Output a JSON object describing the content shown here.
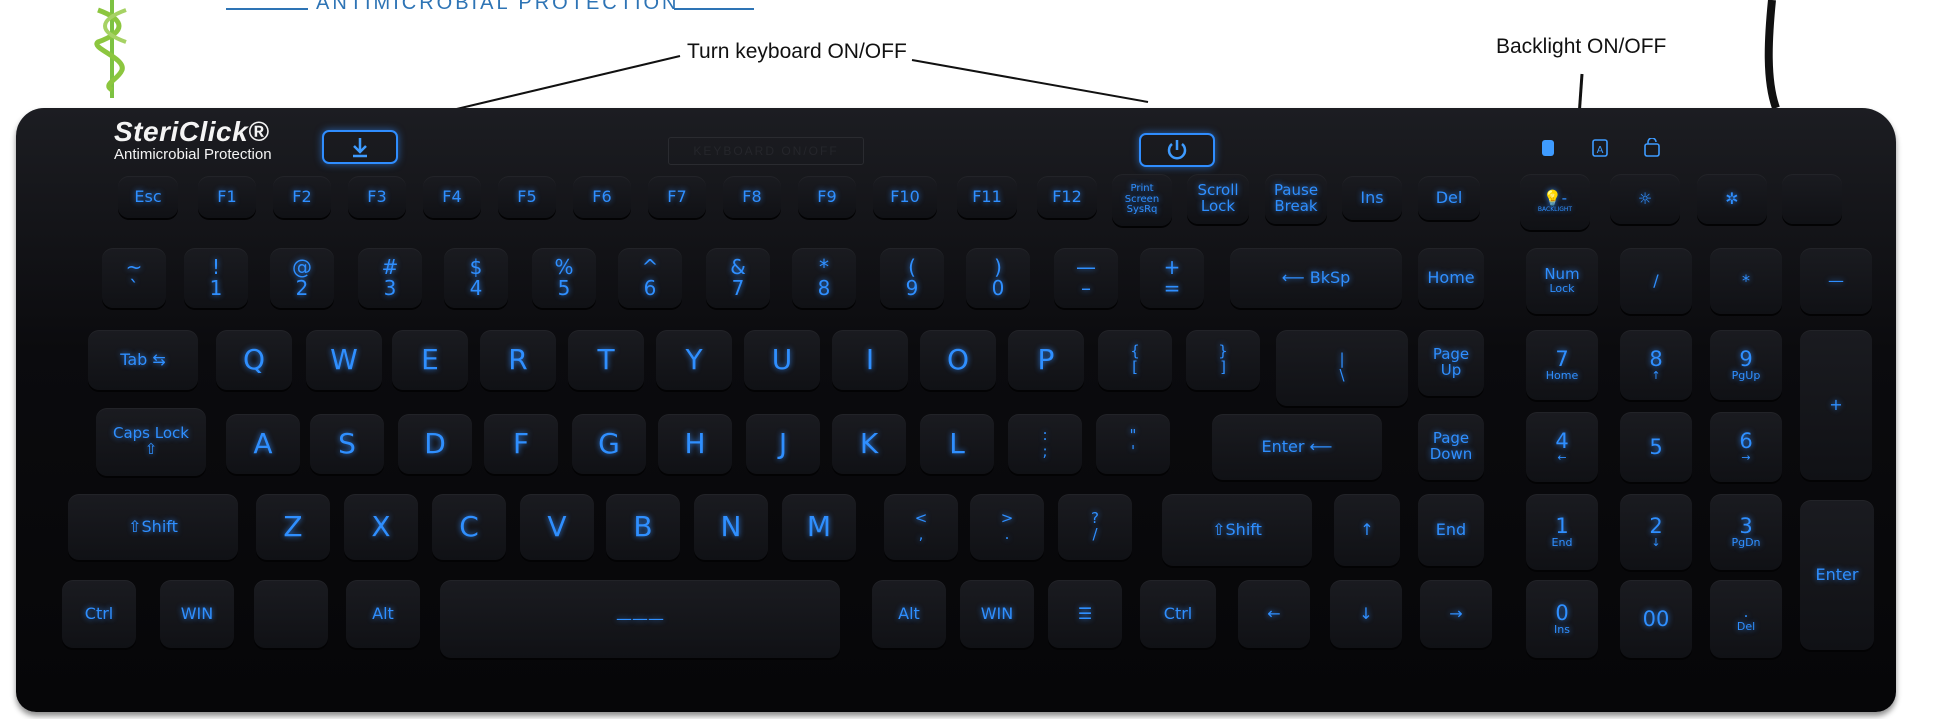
{
  "header": {
    "title": "ANTIMICROBIAL PROTECTION"
  },
  "callouts": {
    "power": "Turn keyboard ON/OFF",
    "backlight": "Backlight ON/OFF"
  },
  "brand": {
    "name": "SteriClick®",
    "tagline": "Antimicrobial Protection"
  },
  "engraving": "KEYBOARD ON/OFF",
  "indicators": [
    "num-lock-indicator-icon",
    "caps-lock-indicator-icon",
    "scroll-lock-indicator-icon"
  ],
  "colors": {
    "key_glow": "#2f8fff",
    "keyboard_body": "#0b0b0e",
    "header_blue": "#2e74b5"
  },
  "keys": [
    {
      "id": "esc",
      "lines": [
        "Esc"
      ]
    },
    {
      "id": "f1",
      "lines": [
        "F1"
      ]
    },
    {
      "id": "f2",
      "lines": [
        "F2"
      ]
    },
    {
      "id": "f3",
      "lines": [
        "F3"
      ]
    },
    {
      "id": "f4",
      "lines": [
        "F4"
      ]
    },
    {
      "id": "f5",
      "lines": [
        "F5"
      ]
    },
    {
      "id": "f6",
      "lines": [
        "F6"
      ]
    },
    {
      "id": "f7",
      "lines": [
        "F7"
      ]
    },
    {
      "id": "f8",
      "lines": [
        "F8"
      ]
    },
    {
      "id": "f9",
      "lines": [
        "F9"
      ]
    },
    {
      "id": "f10",
      "lines": [
        "F10"
      ]
    },
    {
      "id": "f11",
      "lines": [
        "F11"
      ]
    },
    {
      "id": "f12",
      "lines": [
        "F12"
      ]
    },
    {
      "id": "print-screen",
      "lines": [
        "Print",
        "Screen",
        "SysRq"
      ]
    },
    {
      "id": "scroll-lock",
      "lines": [
        "Scroll",
        "Lock"
      ]
    },
    {
      "id": "pause-break",
      "lines": [
        "Pause",
        "Break"
      ]
    },
    {
      "id": "ins",
      "lines": [
        "Ins"
      ]
    },
    {
      "id": "del",
      "lines": [
        "Del"
      ]
    },
    {
      "id": "backlight",
      "lines": [
        "💡-",
        "BACKLIGHT"
      ]
    },
    {
      "id": "brightness-down",
      "lines": [
        "☼"
      ]
    },
    {
      "id": "brightness-up",
      "lines": [
        "✲"
      ]
    },
    {
      "id": "blank-top",
      "lines": [
        ""
      ]
    },
    {
      "id": "tilde",
      "lines": [
        "~",
        "`"
      ]
    },
    {
      "id": "1",
      "lines": [
        "!",
        "1"
      ]
    },
    {
      "id": "2",
      "lines": [
        "@",
        "2"
      ]
    },
    {
      "id": "3",
      "lines": [
        "#",
        "3"
      ]
    },
    {
      "id": "4",
      "lines": [
        "$",
        "4"
      ]
    },
    {
      "id": "5",
      "lines": [
        "%",
        "5"
      ]
    },
    {
      "id": "6",
      "lines": [
        "^",
        "6"
      ]
    },
    {
      "id": "7",
      "lines": [
        "&",
        "7"
      ]
    },
    {
      "id": "8",
      "lines": [
        "*",
        "8"
      ]
    },
    {
      "id": "9",
      "lines": [
        "(",
        "9"
      ]
    },
    {
      "id": "0",
      "lines": [
        ")",
        "0"
      ]
    },
    {
      "id": "minus",
      "lines": [
        "—",
        "–"
      ]
    },
    {
      "id": "equals",
      "lines": [
        "+",
        "="
      ]
    },
    {
      "id": "backspace",
      "lines": [
        "⟵ BkSp"
      ]
    },
    {
      "id": "home",
      "lines": [
        "Home"
      ]
    },
    {
      "id": "num-lock",
      "lines": [
        "Num",
        "Lock"
      ]
    },
    {
      "id": "num-slash",
      "lines": [
        "/"
      ]
    },
    {
      "id": "num-star",
      "lines": [
        "*"
      ]
    },
    {
      "id": "num-minus",
      "lines": [
        "—"
      ]
    },
    {
      "id": "tab",
      "lines": [
        "Tab ⇆"
      ]
    },
    {
      "id": "q",
      "lines": [
        "Q"
      ]
    },
    {
      "id": "w",
      "lines": [
        "W"
      ]
    },
    {
      "id": "e",
      "lines": [
        "E"
      ]
    },
    {
      "id": "r",
      "lines": [
        "R"
      ]
    },
    {
      "id": "t",
      "lines": [
        "T"
      ]
    },
    {
      "id": "y",
      "lines": [
        "Y"
      ]
    },
    {
      "id": "u",
      "lines": [
        "U"
      ]
    },
    {
      "id": "i",
      "lines": [
        "I"
      ]
    },
    {
      "id": "o",
      "lines": [
        "O"
      ]
    },
    {
      "id": "p",
      "lines": [
        "P"
      ]
    },
    {
      "id": "lbrace",
      "lines": [
        "{",
        "["
      ]
    },
    {
      "id": "rbrace",
      "lines": [
        "}",
        "]"
      ]
    },
    {
      "id": "backslash",
      "lines": [
        "|",
        "\\"
      ]
    },
    {
      "id": "page-up",
      "lines": [
        "Page",
        "Up"
      ]
    },
    {
      "id": "num7",
      "lines": [
        "7",
        "Home"
      ]
    },
    {
      "id": "num8",
      "lines": [
        "8",
        "↑"
      ]
    },
    {
      "id": "num9",
      "lines": [
        "9",
        "PgUp"
      ]
    },
    {
      "id": "num-plus",
      "lines": [
        "+"
      ]
    },
    {
      "id": "caps-lock",
      "lines": [
        "Caps Lock",
        "⇧"
      ]
    },
    {
      "id": "a",
      "lines": [
        "A"
      ]
    },
    {
      "id": "s",
      "lines": [
        "S"
      ]
    },
    {
      "id": "d",
      "lines": [
        "D"
      ]
    },
    {
      "id": "f",
      "lines": [
        "F"
      ]
    },
    {
      "id": "g",
      "lines": [
        "G"
      ]
    },
    {
      "id": "h",
      "lines": [
        "H"
      ]
    },
    {
      "id": "j",
      "lines": [
        "J"
      ]
    },
    {
      "id": "k",
      "lines": [
        "K"
      ]
    },
    {
      "id": "l",
      "lines": [
        "L"
      ]
    },
    {
      "id": "semicolon",
      "lines": [
        ":",
        ";"
      ]
    },
    {
      "id": "quote",
      "lines": [
        "\"",
        "'"
      ]
    },
    {
      "id": "enter",
      "lines": [
        "Enter ⟵"
      ]
    },
    {
      "id": "page-down",
      "lines": [
        "Page",
        "Down"
      ]
    },
    {
      "id": "num4",
      "lines": [
        "4",
        "←"
      ]
    },
    {
      "id": "num5",
      "lines": [
        "5"
      ]
    },
    {
      "id": "num6",
      "lines": [
        "6",
        "→"
      ]
    },
    {
      "id": "lshift",
      "lines": [
        "⇧Shift"
      ]
    },
    {
      "id": "z",
      "lines": [
        "Z"
      ]
    },
    {
      "id": "x",
      "lines": [
        "X"
      ]
    },
    {
      "id": "c",
      "lines": [
        "C"
      ]
    },
    {
      "id": "v",
      "lines": [
        "V"
      ]
    },
    {
      "id": "b",
      "lines": [
        "B"
      ]
    },
    {
      "id": "n",
      "lines": [
        "N"
      ]
    },
    {
      "id": "m",
      "lines": [
        "M"
      ]
    },
    {
      "id": "comma",
      "lines": [
        "<",
        ","
      ]
    },
    {
      "id": "period",
      "lines": [
        ">",
        "."
      ]
    },
    {
      "id": "slash",
      "lines": [
        "?",
        "/"
      ]
    },
    {
      "id": "rshift",
      "lines": [
        "⇧Shift"
      ]
    },
    {
      "id": "arrow-up",
      "lines": [
        "↑"
      ]
    },
    {
      "id": "end",
      "lines": [
        "End"
      ]
    },
    {
      "id": "num1",
      "lines": [
        "1",
        "End"
      ]
    },
    {
      "id": "num2",
      "lines": [
        "2",
        "↓"
      ]
    },
    {
      "id": "num3",
      "lines": [
        "3",
        "PgDn"
      ]
    },
    {
      "id": "num-enter",
      "lines": [
        "Enter"
      ]
    },
    {
      "id": "lctrl",
      "lines": [
        "Ctrl"
      ]
    },
    {
      "id": "lwin",
      "lines": [
        "WIN"
      ]
    },
    {
      "id": "blank-bottom",
      "lines": [
        ""
      ]
    },
    {
      "id": "lalt",
      "lines": [
        "Alt"
      ]
    },
    {
      "id": "space",
      "lines": [
        "———"
      ]
    },
    {
      "id": "ralt",
      "lines": [
        "Alt"
      ]
    },
    {
      "id": "rwin",
      "lines": [
        "WIN"
      ]
    },
    {
      "id": "menu",
      "lines": [
        "☰"
      ]
    },
    {
      "id": "rctrl",
      "lines": [
        "Ctrl"
      ]
    },
    {
      "id": "arrow-left",
      "lines": [
        "←"
      ]
    },
    {
      "id": "arrow-down",
      "lines": [
        "↓"
      ]
    },
    {
      "id": "arrow-right",
      "lines": [
        "→"
      ]
    },
    {
      "id": "num0",
      "lines": [
        "0",
        "Ins"
      ]
    },
    {
      "id": "num00",
      "lines": [
        "00"
      ]
    },
    {
      "id": "num-dot",
      "lines": [
        ".",
        "Del"
      ]
    }
  ]
}
